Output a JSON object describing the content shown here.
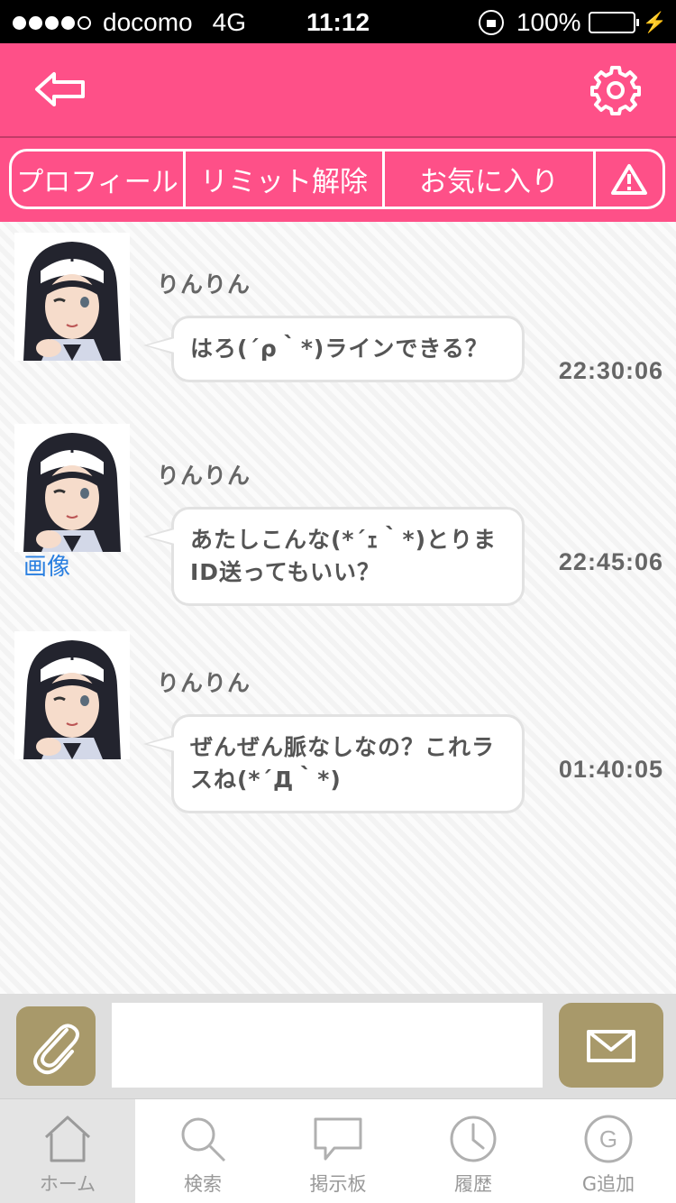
{
  "status_bar": {
    "carrier": "docomo",
    "network": "4G",
    "time": "11:12",
    "battery": "100%"
  },
  "colors": {
    "header": "#fe5088",
    "accent_button": "#a8996a",
    "link": "#2a7fe0"
  },
  "header": {
    "back_icon": "back-arrow-icon",
    "settings_icon": "gear-icon",
    "tabs": [
      {
        "label": "プロフィール"
      },
      {
        "label": "リミット解除"
      },
      {
        "label": "お気に入り"
      },
      {
        "icon": "warning-icon"
      }
    ]
  },
  "messages": [
    {
      "sender": "りんりん",
      "text": "はろ(´ρ｀*)ラインできる？",
      "time": "22:30:06"
    },
    {
      "sender": "りんりん",
      "text": "あたしこんな(*´ｪ｀*)とりまID送ってもいい？",
      "time": "22:45:06",
      "image_link": "画像"
    },
    {
      "sender": "りんりん",
      "text": "ぜんぜん脈なしなの？これラスね(*´Д｀*)",
      "time": "01:40:05"
    }
  ],
  "composer": {
    "attach_icon": "paperclip-icon",
    "input_value": "",
    "send_icon": "envelope-icon"
  },
  "bottom_nav": [
    {
      "label": "ホーム",
      "icon": "home-icon",
      "active": true
    },
    {
      "label": "検索",
      "icon": "search-icon"
    },
    {
      "label": "掲示板",
      "icon": "chat-bubble-icon"
    },
    {
      "label": "履歴",
      "icon": "clock-icon"
    },
    {
      "label": "G追加",
      "icon": "g-circle-icon"
    }
  ]
}
